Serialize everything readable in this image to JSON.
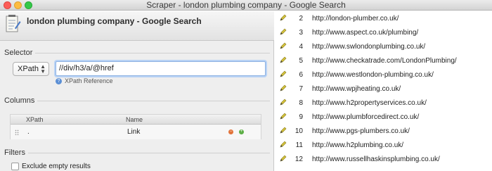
{
  "window": {
    "title": "Scraper - london plumbing company - Google Search"
  },
  "header": {
    "title": "london plumbing company - Google Search"
  },
  "selector": {
    "section_label": "Selector",
    "type_value": "XPath",
    "xpath_value": "//div/h3/a/@href",
    "reference_link": "XPath Reference"
  },
  "columns": {
    "section_label": "Columns",
    "headers": {
      "xpath": "XPath",
      "name": "Name"
    },
    "rows": [
      {
        "xpath": ".",
        "name": "Link"
      }
    ]
  },
  "filters": {
    "section_label": "Filters",
    "exclude_empty_label": "Exclude empty results"
  },
  "results": [
    {
      "num": "2",
      "url": "http://london-plumber.co.uk/"
    },
    {
      "num": "3",
      "url": "http://www.aspect.co.uk/plumbing/"
    },
    {
      "num": "4",
      "url": "http://www.swlondonplumbing.co.uk/"
    },
    {
      "num": "5",
      "url": "http://www.checkatrade.com/LondonPlumbing/"
    },
    {
      "num": "6",
      "url": "http://www.westlondon-plumbing.co.uk/"
    },
    {
      "num": "7",
      "url": "http://www.wpjheating.co.uk/"
    },
    {
      "num": "8",
      "url": "http://www.h2propertyservices.co.uk/"
    },
    {
      "num": "9",
      "url": "http://www.plumbforcedirect.co.uk/"
    },
    {
      "num": "10",
      "url": "http://www.pgs-plumbers.co.uk/"
    },
    {
      "num": "11",
      "url": "http://www.h2plumbing.co.uk/"
    },
    {
      "num": "12",
      "url": "http://www.russellhaskinsplumbing.co.uk/"
    }
  ]
}
